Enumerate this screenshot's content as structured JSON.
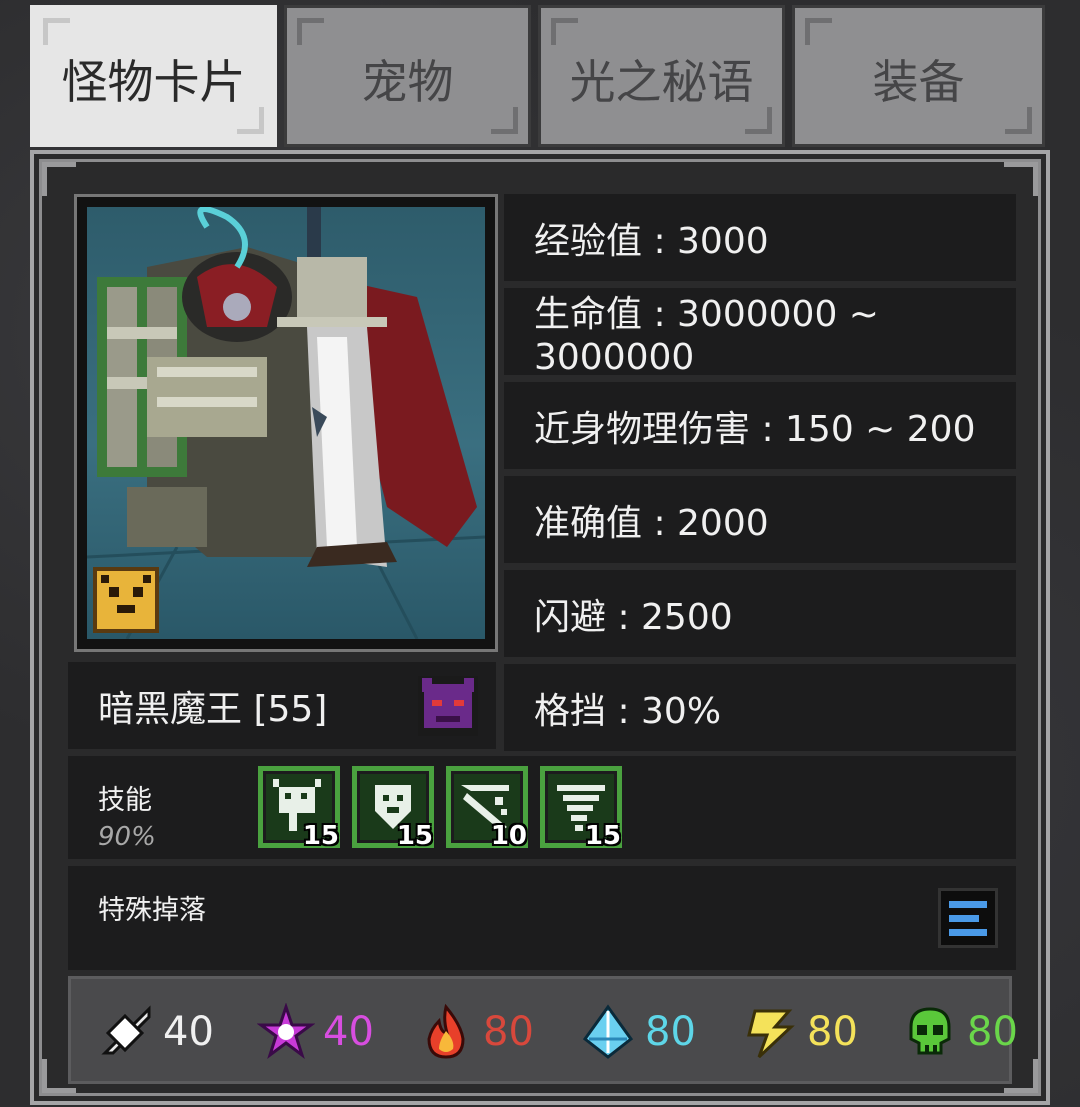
{
  "tabs": [
    {
      "label": "怪物卡片",
      "active": true
    },
    {
      "label": "宠物",
      "active": false
    },
    {
      "label": "光之秘语",
      "active": false
    },
    {
      "label": "装备",
      "active": false
    }
  ],
  "monster": {
    "name": "暗黑魔王 [55]",
    "type_icon": "demon-mask-icon",
    "badge_icon": "tiger-badge-icon"
  },
  "stats": [
    {
      "label": "经验值 : 3000"
    },
    {
      "label": "生命值 : 3000000 ~ 3000000"
    },
    {
      "label": "近身物理伤害 : 150 ~ 200"
    },
    {
      "label": "准确值 : 2000"
    },
    {
      "label": "闪避 : 2500"
    },
    {
      "label": "格挡 : 30%"
    }
  ],
  "skills": {
    "label": "技能",
    "chance": "90%",
    "items": [
      {
        "icon": "skill-beast-icon",
        "count": "15"
      },
      {
        "icon": "skill-shield-icon",
        "count": "15"
      },
      {
        "icon": "skill-slash-icon",
        "count": "10"
      },
      {
        "icon": "skill-tornado-icon",
        "count": "15"
      }
    ]
  },
  "drops": {
    "label": "特殊掉落",
    "button_icon": "list-icon"
  },
  "resistances": [
    {
      "icon": "physical-sword-icon",
      "value": "40",
      "color": "#f0f0f0"
    },
    {
      "icon": "arcane-star-icon",
      "value": "40",
      "color": "#d84ee0"
    },
    {
      "icon": "fire-icon",
      "value": "80",
      "color": "#d8483c"
    },
    {
      "icon": "ice-crystal-icon",
      "value": "80",
      "color": "#5ed6e8"
    },
    {
      "icon": "lightning-icon",
      "value": "80",
      "color": "#f4e25a"
    },
    {
      "icon": "poison-skull-icon",
      "value": "80",
      "color": "#6ad64a"
    }
  ]
}
